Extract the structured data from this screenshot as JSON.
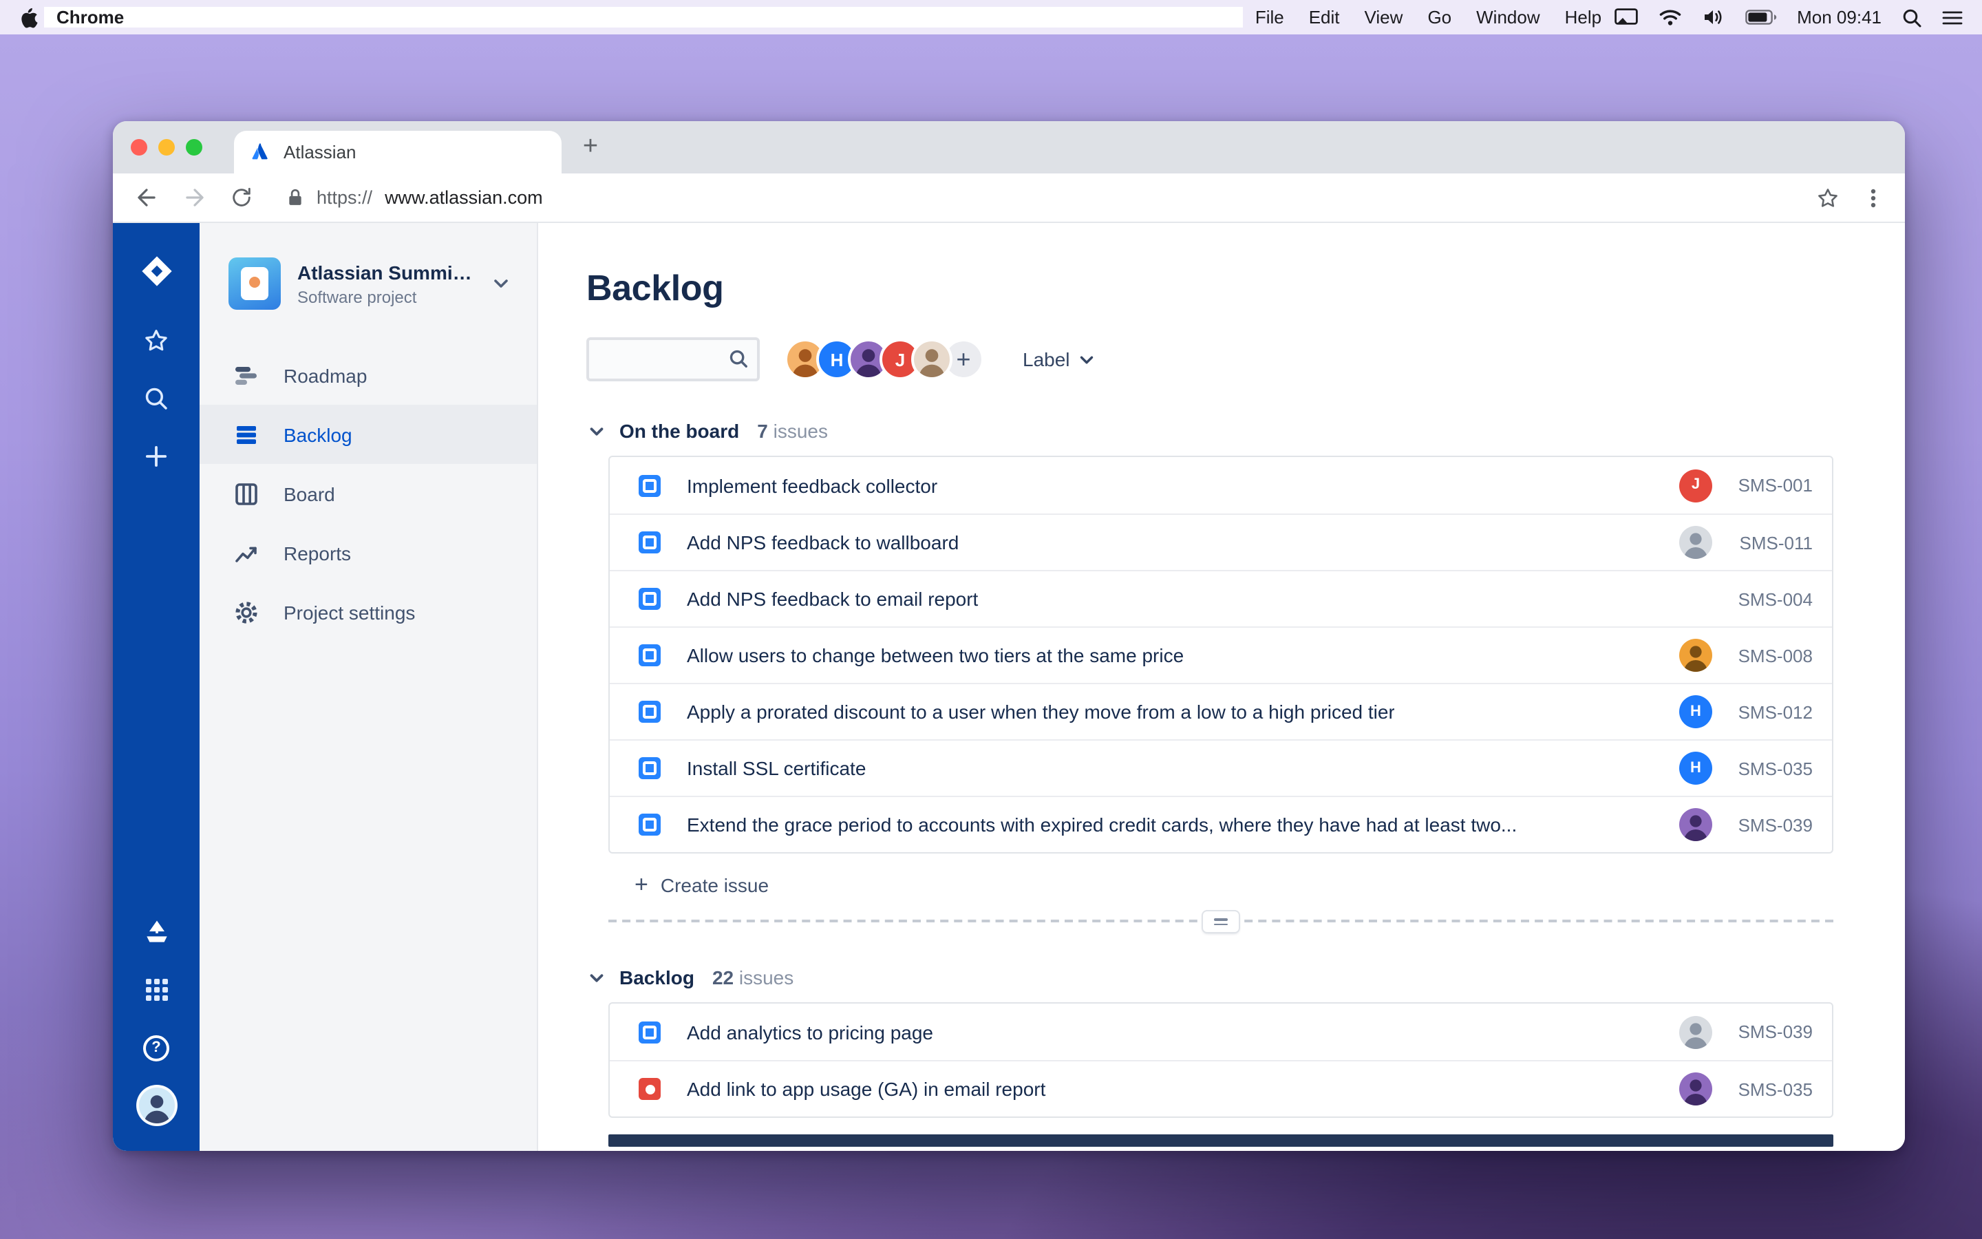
{
  "menu_bar": {
    "app_menus": [
      "Chrome",
      "File",
      "Edit",
      "View",
      "Go",
      "Window",
      "Help"
    ],
    "clock": "Mon 09:41",
    "status_icons": [
      "screen-mirroring-icon",
      "wifi-icon",
      "volume-icon",
      "battery-icon",
      "spotlight-icon",
      "control-center-icon"
    ]
  },
  "browser": {
    "tab_title": "Atlassian",
    "url_scheme": "https://",
    "url_host": "www.atlassian.com"
  },
  "nav_rail": {
    "icons": [
      "jira-logo",
      "star-icon",
      "search-icon",
      "plus-icon",
      "ship-icon",
      "app-switcher-icon",
      "help-icon",
      "profile-avatar"
    ]
  },
  "sidebar": {
    "project_name": "Atlassian Summit...",
    "project_type": "Software project",
    "items": [
      {
        "label": "Roadmap"
      },
      {
        "label": "Backlog"
      },
      {
        "label": "Board"
      },
      {
        "label": "Reports"
      },
      {
        "label": "Project settings"
      }
    ]
  },
  "main": {
    "title": "Backlog",
    "filters": {
      "label_dropdown": "Label"
    },
    "header_avatars": [
      {
        "kind": "photo",
        "bg": "#F5B36B",
        "fg": "#A3571E"
      },
      {
        "kind": "initial",
        "initial": "H",
        "bg": "#1D7AFC"
      },
      {
        "kind": "photo",
        "bg": "#8F6BBF",
        "fg": "#3F2A66"
      },
      {
        "kind": "initial",
        "initial": "J",
        "bg": "#E5483D"
      },
      {
        "kind": "photo",
        "bg": "#E8DACC",
        "fg": "#9A7B5C"
      }
    ],
    "sections": [
      {
        "name": "On the board",
        "count": "7",
        "count_suffix": "issues",
        "create_label": "Create issue",
        "issues": [
          {
            "type": "story",
            "title": "Implement feedback collector",
            "key": "SMS-001",
            "avatar": {
              "kind": "initial",
              "initial": "J",
              "bg": "#E5483D"
            }
          },
          {
            "type": "story",
            "title": "Add NPS feedback to wallboard",
            "key": "SMS-011",
            "avatar": {
              "kind": "photo",
              "bg": "#D8DCE1",
              "fg": "#8C96A5"
            }
          },
          {
            "type": "story",
            "title": "Add NPS feedback to email report",
            "key": "SMS-004"
          },
          {
            "type": "story",
            "title": "Allow users to change between two tiers at the same price",
            "key": "SMS-008",
            "avatar": {
              "kind": "photo",
              "bg": "#F0A136",
              "fg": "#7A4E12"
            }
          },
          {
            "type": "story",
            "title": "Apply a prorated discount to a user when they move from a low to a high priced tier",
            "key": "SMS-012",
            "avatar": {
              "kind": "initial",
              "initial": "H",
              "bg": "#1D7AFC"
            }
          },
          {
            "type": "story",
            "title": "Install SSL certificate",
            "key": "SMS-035",
            "avatar": {
              "kind": "initial",
              "initial": "H",
              "bg": "#1D7AFC"
            }
          },
          {
            "type": "story",
            "title": "Extend the grace period to accounts with expired credit cards, where they have had at least two...",
            "key": "SMS-039",
            "avatar": {
              "kind": "photo",
              "bg": "#8F6BBF",
              "fg": "#3F2A66"
            }
          }
        ]
      },
      {
        "name": "Backlog",
        "count": "22",
        "count_suffix": "issues",
        "issues": [
          {
            "type": "story",
            "title": "Add analytics to pricing page",
            "key": "SMS-039",
            "avatar": {
              "kind": "photo",
              "bg": "#D8DCE1",
              "fg": "#8C96A5"
            }
          },
          {
            "type": "bug",
            "title": "Add link to app usage (GA) in email report",
            "key": "SMS-035",
            "avatar": {
              "kind": "photo",
              "bg": "#8F6BBF",
              "fg": "#3F2A66"
            }
          }
        ]
      }
    ]
  }
}
